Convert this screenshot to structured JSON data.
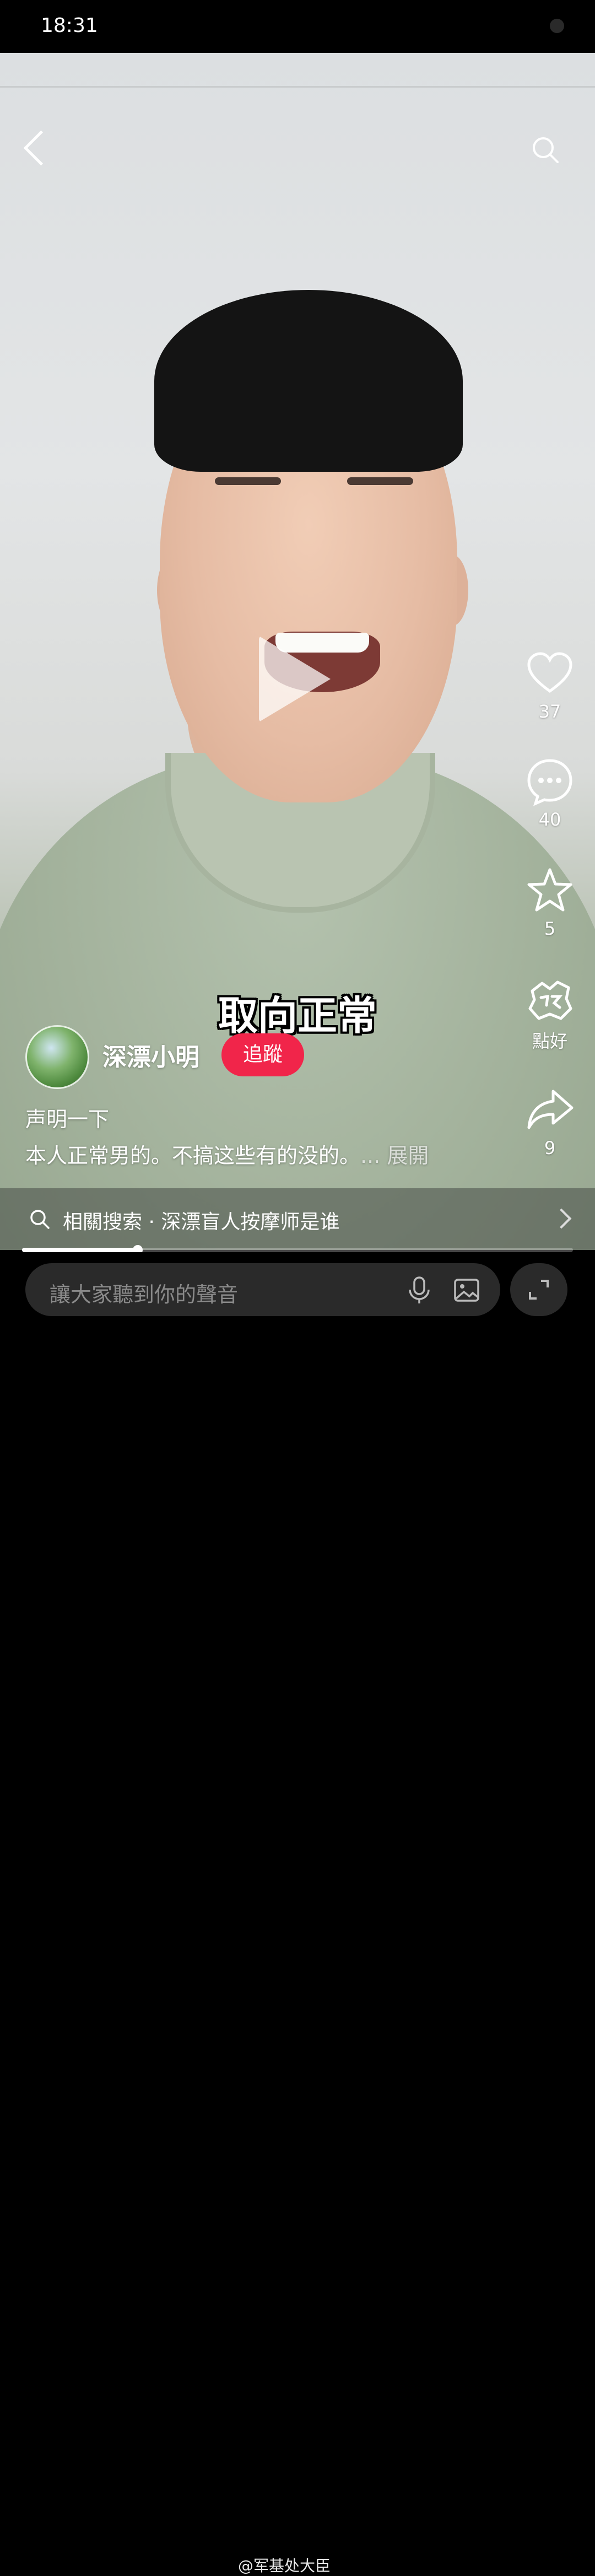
{
  "status_bar": {
    "time": "18:31"
  },
  "video": {
    "caption": "取向正常"
  },
  "side_actions": {
    "like_count": "37",
    "comment_count": "40",
    "favorite_count": "5",
    "reaction_label": "點好",
    "share_count": "9"
  },
  "author": {
    "name": "深漂小明",
    "follow_label": "追蹤"
  },
  "description": {
    "line1": "声明一下",
    "line2": "本人正常男的。不搞这些有的没的。",
    "more": "... 展開"
  },
  "related": {
    "text": "相關搜索 · 深漂盲人按摩师是谁"
  },
  "progress": {
    "fraction": 0.21
  },
  "comment_bar": {
    "placeholder": "讓大家聽到你的聲音"
  },
  "watermark": "@军基处大臣",
  "colors": {
    "follow": "#f1254a",
    "background": "#000000"
  },
  "icons": [
    "back-icon",
    "search-icon",
    "play-icon",
    "heart-icon",
    "comment-icon",
    "star-icon",
    "reaction-icon",
    "share-icon",
    "mic-icon",
    "image-icon",
    "expand-icon"
  ]
}
